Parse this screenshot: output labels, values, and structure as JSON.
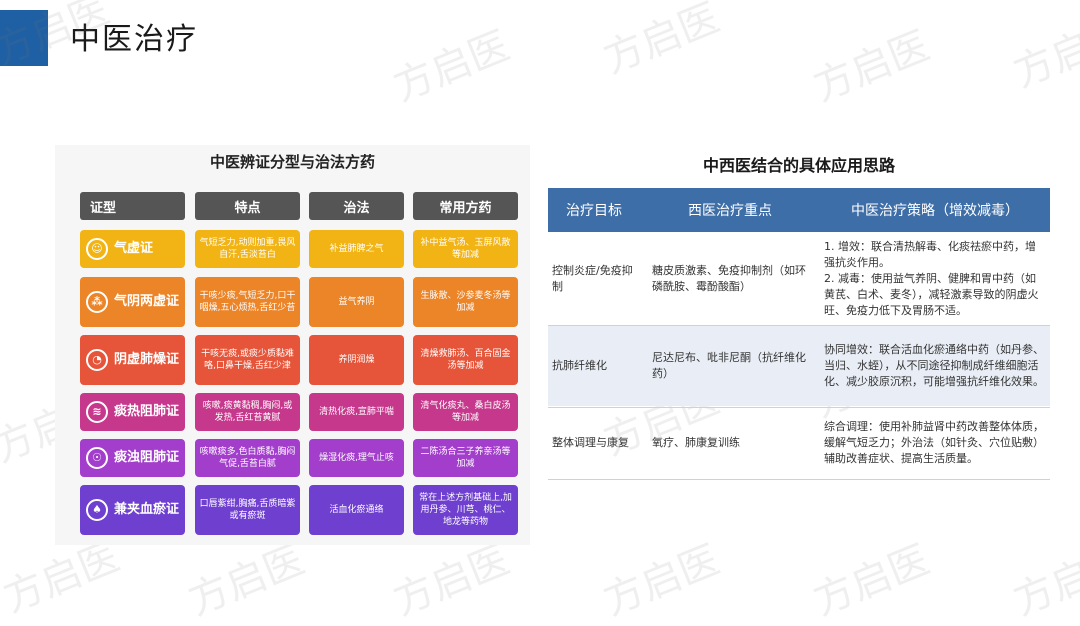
{
  "page": {
    "title": "中医治疗",
    "watermark": "方启医"
  },
  "left": {
    "title": "中医辨证分型与治法方药",
    "headers": [
      "证型",
      "特点",
      "治法",
      "常用方药"
    ],
    "rows": [
      {
        "name": "气虚证",
        "icon": "face-icon",
        "feature": "气短乏力,动则加重,畏风自汗,舌淡苔白",
        "treatment": "补益肺脾之气",
        "formula": "补中益气汤、玉屏风散等加减",
        "color": "#f2b414"
      },
      {
        "name": "气阴两虚证",
        "icon": "lungs-icon",
        "feature": "干咳少痰,气短乏力,口干咽燥,五心烦热,舌红少苔",
        "treatment": "益气养阴",
        "formula": "生脉散、沙参麦冬汤等加减",
        "color": "#ec8428"
      },
      {
        "name": "阴虚肺燥证",
        "icon": "gauge-icon",
        "feature": "干咳无痰,或痰少质黏难咯,口鼻干燥,舌红少津",
        "treatment": "养阴润燥",
        "formula": "清燥救肺汤、百合固金汤等加减",
        "color": "#e6553a"
      },
      {
        "name": "痰热阻肺证",
        "icon": "cough-icon",
        "feature": "咳嗽,痰黄黏稠,胸闷,或发热,舌红苔黄腻",
        "treatment": "清热化痰,宣肺平喘",
        "formula": "清气化痰丸、桑白皮汤等加减",
        "color": "#c6388c"
      },
      {
        "name": "痰浊阻肺证",
        "icon": "head-icon",
        "feature": "咳嗽痰多,色白质黏,胸闷气促,舌苔白腻",
        "treatment": "燥湿化痰,理气止咳",
        "formula": "二陈汤合三子养亲汤等加减",
        "color": "#a23ecb"
      },
      {
        "name": "兼夹血瘀证",
        "icon": "lung-icon",
        "feature": "口唇紫绀,胸痛,舌质暗紫或有瘀斑",
        "treatment": "活血化瘀通络",
        "formula": "常在上述方剂基础上,加用丹参、川芎、桃仁、地龙等药物",
        "color": "#6f3fd0"
      }
    ]
  },
  "right": {
    "title": "中西医结合的具体应用思路",
    "headers": [
      "治疗目标",
      "西医治疗重点",
      "中医治疗策略（增效减毒）"
    ],
    "rows": [
      {
        "goal": "控制炎症/免疫抑制",
        "western": "糖皮质激素、免疫抑制剂（如环磷酰胺、霉酚酸酯）",
        "tcm": "1. 增效：联合清热解毒、化痰祛瘀中药，增强抗炎作用。\n2. 减毒：使用益气养阴、健脾和胃中药（如黄芪、白术、麦冬），减轻激素导致的阴虚火旺、免疫力低下及胃肠不适。"
      },
      {
        "goal": "抗肺纤维化",
        "western": "尼达尼布、吡非尼酮（抗纤维化药）",
        "tcm": "协同增效：联合活血化瘀通络中药（如丹参、当归、水蛭），从不同途径抑制成纤维细胞活化、减少胶原沉积，可能增强抗纤维化效果。"
      },
      {
        "goal": "整体调理与康复",
        "western": "氧疗、肺康复训练",
        "tcm": "综合调理：使用补肺益肾中药改善整体体质，缓解气短乏力；外治法（如针灸、穴位贴敷）辅助改善症状、提高生活质量。"
      }
    ]
  }
}
